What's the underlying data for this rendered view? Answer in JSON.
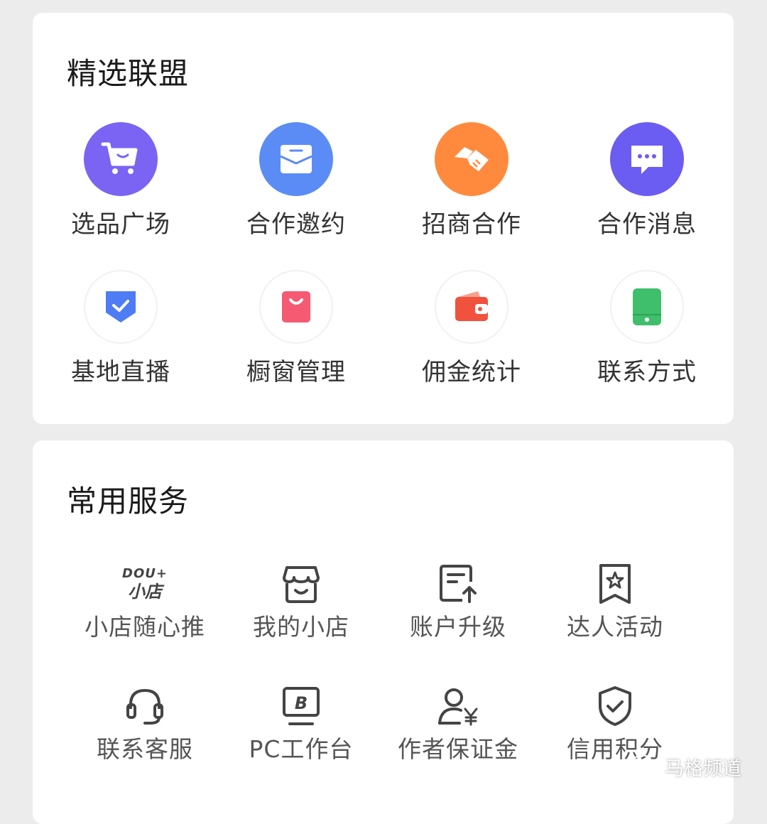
{
  "alliance": {
    "title": "精选联盟",
    "items": [
      {
        "label": "选品广场",
        "icon": "cart-icon",
        "color": "#7b63f4"
      },
      {
        "label": "合作邀约",
        "icon": "envelope-icon",
        "color": "#5b8cf6"
      },
      {
        "label": "招商合作",
        "icon": "handshake-icon",
        "color": "#ff8a3d"
      },
      {
        "label": "合作消息",
        "icon": "chat-bubble-icon",
        "color": "#6b5cf2"
      },
      {
        "label": "基地直播",
        "icon": "shield-check-icon",
        "color": "#4e7cf5"
      },
      {
        "label": "橱窗管理",
        "icon": "shopping-bag-icon",
        "color": "#f55a72"
      },
      {
        "label": "佣金统计",
        "icon": "wallet-icon",
        "color": "#f0523e"
      },
      {
        "label": "联系方式",
        "icon": "phone-icon",
        "color": "#3fbf6b"
      }
    ]
  },
  "services": {
    "title": "常用服务",
    "items": [
      {
        "label": "小店随心推",
        "icon": "dou-shop-logo-icon",
        "logo_line1": "DOU+",
        "logo_line2": "小店"
      },
      {
        "label": "我的小店",
        "icon": "store-icon"
      },
      {
        "label": "账户升级",
        "icon": "document-upload-icon"
      },
      {
        "label": "达人活动",
        "icon": "star-badge-icon"
      },
      {
        "label": "联系客服",
        "icon": "headset-icon"
      },
      {
        "label": "PC工作台",
        "icon": "monitor-b-icon"
      },
      {
        "label": "作者保证金",
        "icon": "user-yen-icon"
      },
      {
        "label": "信用积分",
        "icon": "shield-check-outline-icon"
      }
    ]
  },
  "watermark": {
    "text": "马格频道",
    "icon": "wechat-icon"
  }
}
